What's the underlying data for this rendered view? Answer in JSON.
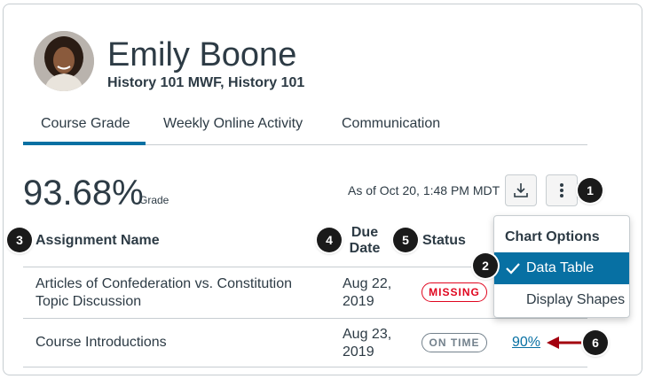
{
  "student": {
    "name": "Emily Boone",
    "courses": "History 101 MWF, History 101"
  },
  "tabs": [
    {
      "label": "Course Grade",
      "active": true
    },
    {
      "label": "Weekly Online Activity",
      "active": false
    },
    {
      "label": "Communication",
      "active": false
    }
  ],
  "grade": {
    "value": "93.68%",
    "label": "Grade",
    "as_of": "As of Oct 20, 1:48 PM MDT"
  },
  "toolbar": {
    "download_icon": "download-icon",
    "menu_icon": "kebab-menu-icon"
  },
  "table": {
    "headers": {
      "assignment": "Assignment Name",
      "due_line1": "Due",
      "due_line2": "Date",
      "status": "Status"
    },
    "rows": [
      {
        "name_line1": "Articles of Confederation vs. Constitution",
        "name_line2": "Topic Discussion",
        "due_line1": "Aug 22,",
        "due_line2": "2019",
        "status": "MISSING",
        "score": ""
      },
      {
        "name_line1": "Course Introductions",
        "name_line2": "",
        "due_line1": "Aug 23,",
        "due_line2": "2019",
        "status": "ON TIME",
        "score": "90%"
      }
    ]
  },
  "chart_options_menu": {
    "title": "Chart Options",
    "items": [
      {
        "label": "Data Table",
        "selected": true
      },
      {
        "label": "Display Shapes",
        "selected": false
      }
    ]
  },
  "callouts": [
    "1",
    "2",
    "3",
    "4",
    "5",
    "6"
  ],
  "colors": {
    "accent": "#0770a3",
    "text": "#2d3b45",
    "missing": "#e0061f",
    "ontime": "#73818c",
    "arrow": "#a3010f"
  }
}
